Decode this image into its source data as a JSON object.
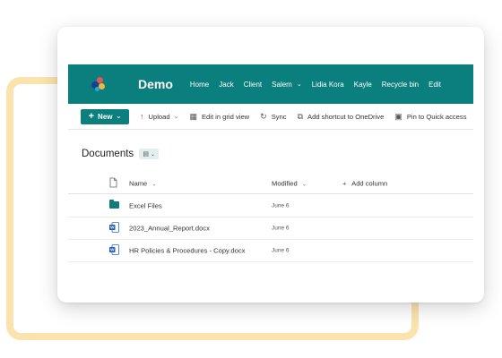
{
  "site": {
    "title": "Demo"
  },
  "nav": {
    "items": [
      "Home",
      "Jack",
      "Client",
      "Salem",
      "Lidia Kora",
      "Kayle",
      "Recycle bin",
      "Edit"
    ]
  },
  "commands": {
    "new": "New",
    "upload": "Upload",
    "edit_grid": "Edit in grid view",
    "sync": "Sync",
    "add_shortcut": "Add shortcut to OneDrive",
    "pin": "Pin to Quick access"
  },
  "library": {
    "title": "Documents"
  },
  "columns": {
    "name": "Name",
    "modified": "Modified",
    "add": "Add column"
  },
  "files": [
    {
      "type": "folder",
      "name": "Excel Files",
      "modified": "June 6"
    },
    {
      "type": "word",
      "name": "2023_Annual_Report.docx",
      "modified": "June 6"
    },
    {
      "type": "word",
      "name": "HR Policies & Procedures - Copy.docx",
      "modified": "June 6"
    }
  ],
  "colors": {
    "brand": "#0b7f7d",
    "decor": "#fbe3ad"
  }
}
